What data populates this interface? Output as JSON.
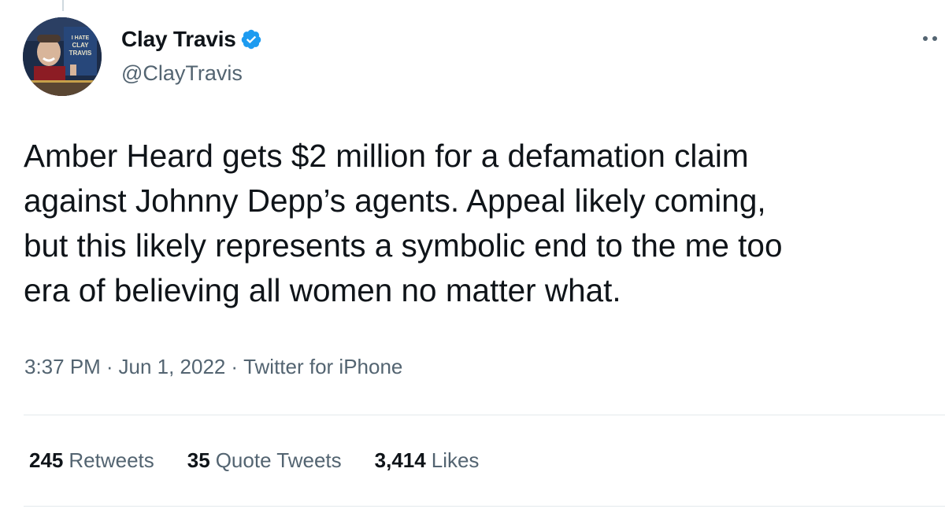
{
  "user": {
    "display_name": "Clay Travis",
    "handle": "@ClayTravis",
    "avatar_sign_text": "I HATE CLAY TRAVIS",
    "verified": true
  },
  "tweet": {
    "text": "Amber Heard gets $2 million for a defamation claim\nagainst Johnny Depp’s agents. Appeal likely coming,\nbut this likely represents a symbolic end to the me too\nera of believing all women no matter what.",
    "time": "3:37 PM",
    "separator": "·",
    "date": "Jun 1, 2022",
    "source": "Twitter for iPhone"
  },
  "stats": {
    "retweets": {
      "count": "245",
      "label": "Retweets"
    },
    "quote_tweets": {
      "count": "35",
      "label": "Quote Tweets"
    },
    "likes": {
      "count": "3,414",
      "label": "Likes"
    }
  },
  "icons": {
    "verified": "verified-badge-icon",
    "more": "more-options-icon"
  },
  "colors": {
    "text": "#0f1419",
    "secondary": "#536471",
    "verified_blue": "#1d9bf0",
    "divider": "#e4e9ec"
  }
}
